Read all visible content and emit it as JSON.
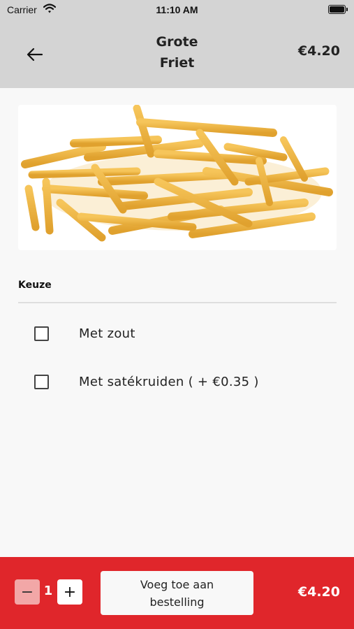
{
  "status_bar": {
    "carrier": "Carrier",
    "time": "11:10 AM"
  },
  "header": {
    "back_icon": "arrow-left-icon",
    "title": "Grote\nFriet",
    "price": "€4.20"
  },
  "product": {
    "image": "french-fries-image"
  },
  "options": {
    "title": "Keuze",
    "items": [
      {
        "label": "Met zout",
        "checked": false
      },
      {
        "label": "Met satékruiden ( + €0.35 )",
        "checked": false
      }
    ]
  },
  "footer": {
    "minus_label": "−",
    "quantity": "1",
    "plus_label": "+",
    "add_label": "Voeg toe aan\nbestelling",
    "price": "€4.20"
  },
  "colors": {
    "header_bg": "#d4d4d4",
    "footer_bg": "#e0262b",
    "minus_bg": "#f2a7a7"
  }
}
